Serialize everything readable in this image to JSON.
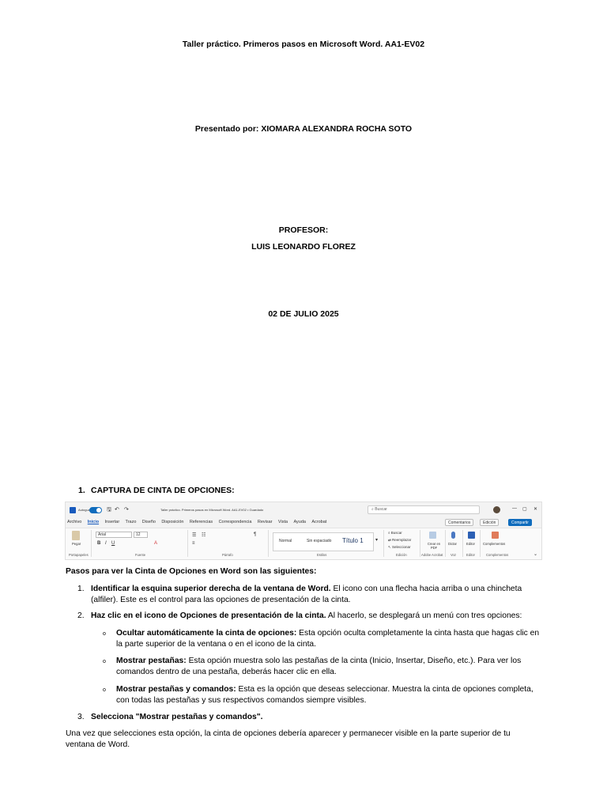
{
  "cover": {
    "title": "Taller práctico. Primeros pasos en Microsoft Word. AA1-EV02",
    "presented_by": "Presentado por: XIOMARA ALEXANDRA ROCHA SOTO",
    "professor_label": "PROFESOR:",
    "professor_name": "LUIS LEONARDO FLOREZ",
    "date": "02 DE JULIO 2025"
  },
  "section1": {
    "number": "1.",
    "title": "CAPTURA DE CINTA DE OPCIONES:"
  },
  "ribbon": {
    "autosave": "Autoguardado",
    "doc_title": "Taller práctico. Primeros pasos en Microsoft Word. AA1-EV02 • Guardado",
    "search_placeholder": "Buscar",
    "window_controls": [
      "—",
      "▢",
      "✕"
    ],
    "tabs": [
      "Archivo",
      "Inicio",
      "Insertar",
      "Trazo",
      "Diseño",
      "Disposición",
      "Referencias",
      "Correspondencia",
      "Revisar",
      "Vista",
      "Ayuda",
      "Acrobat"
    ],
    "comments": "Comentarios",
    "editing": "Edición",
    "share": "Compartir",
    "paste": "Pegar",
    "font_name": "Arial",
    "font_size": "12",
    "styles": [
      "Normal",
      "Sin espaciado",
      "Título 1"
    ],
    "find": "Buscar",
    "replace": "Reemplazar",
    "select": "Seleccionar",
    "create_pdf": "Crear en PDF",
    "dictate": "Dictar",
    "editor": "Editor",
    "addins": "Complementos",
    "groups": [
      "Portapapeles",
      "Fuente",
      "Párrafo",
      "Estilos",
      "Edición",
      "Adobe Acrobat",
      "Voz",
      "Editor",
      "Complementos"
    ]
  },
  "steps": {
    "intro": "Pasos para ver la Cinta de Opciones en Word son las siguientes:",
    "items": [
      {
        "n": "1.",
        "bold": "Identificar la esquina superior derecha de la ventana de Word.",
        "text": " El icono con una flecha hacia arriba o una chincheta (alfiler). Este es el control para las opciones de presentación de la cinta."
      },
      {
        "n": "2.",
        "bold": "Haz clic en el icono de Opciones de presentación de la cinta.",
        "text": " Al hacerlo, se desplegará un menú con tres opciones:"
      },
      {
        "n": "3.",
        "bold": "Selecciona \"Mostrar pestañas y comandos\".",
        "text": ""
      }
    ],
    "options": [
      {
        "bullet": "o",
        "bold": "Ocultar automáticamente la cinta de opciones:",
        "text": " Esta opción oculta completamente la cinta hasta que hagas clic en la parte superior de la ventana o en el icono de la cinta."
      },
      {
        "bullet": "o",
        "bold": "Mostrar pestañas:",
        "text": " Esta opción muestra solo las pestañas de la cinta (Inicio, Insertar, Diseño, etc.). Para ver los comandos dentro de una pestaña, deberás hacer clic en ella."
      },
      {
        "bullet": "o",
        "bold": "Mostrar pestañas y comandos:",
        "text": " Esta es la opción que deseas seleccionar. Muestra la cinta de opciones completa, con todas las pestañas y sus respectivos comandos siempre visibles."
      }
    ],
    "conclusion": "Una vez que selecciones esta opción, la cinta de opciones debería aparecer y permanecer visible en la parte superior de tu ventana de Word."
  }
}
